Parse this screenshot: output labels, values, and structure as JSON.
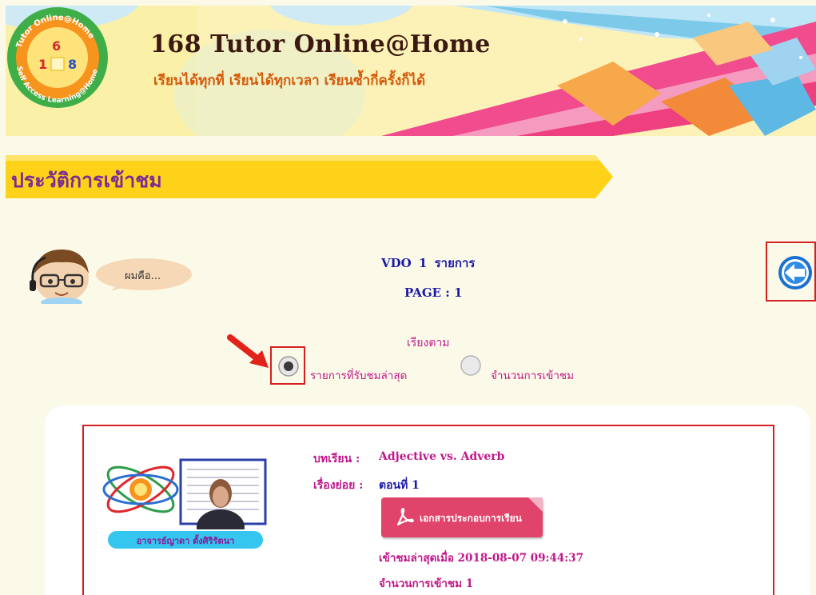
{
  "header": {
    "logo_text_top": "Tutor Online@Home",
    "logo_text_bottom": "Self Access Learning@Home",
    "logo_number": "168",
    "site_title": "168 Tutor Online@Home",
    "slogan": "เรียนได้ทุกที่ เรียนได้ทุกเวลา เรียนซ้ำกี่ครั้งก็ได้"
  },
  "section": {
    "title": "ประวัติการเข้าชม"
  },
  "mascot": {
    "speech": "ผมคือ..."
  },
  "summary": {
    "vdo_label": "VDO",
    "vdo_count": "1",
    "vdo_unit": "รายการ",
    "page_label": "PAGE :",
    "page_number": "1"
  },
  "sort": {
    "label": "เรียงตาม",
    "options": [
      {
        "label": "รายการที่รับชมล่าสุด",
        "selected": true
      },
      {
        "label": "จำนวนการเข้าชม",
        "selected": false
      }
    ]
  },
  "items": [
    {
      "teacher": "อาจารย์ญาดา ตั้งศิริรัตนา",
      "lesson_label": "บทเรียน :",
      "lesson": "Adjective vs. Adverb",
      "sub_label": "เรื่องย่อย :",
      "sub": "ตอนที่ 1",
      "doc_button": "เอกสารประกอบการเรียน",
      "last_viewed": "เข้าชมล่าสุดเมื่อ 2018-08-07 09:44:37",
      "view_count": "จำนวนการเข้าชม 1"
    }
  ],
  "colors": {
    "title_purple": "#7b2d93",
    "magenta": "#c0168a",
    "navy": "#1a1aa8",
    "yellow_bar": "#ffd21a",
    "pdf_button": "#e0446a",
    "highlight_red": "#d42020"
  }
}
